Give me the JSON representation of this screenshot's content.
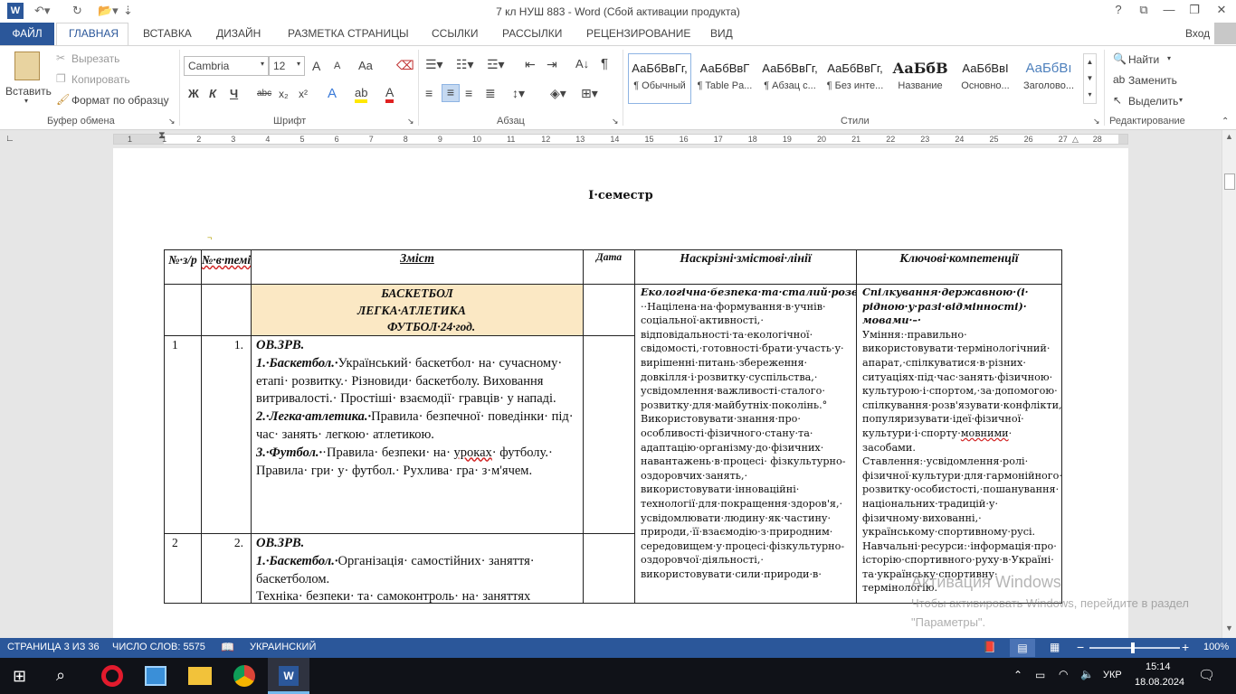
{
  "window": {
    "title": "7 кл НУШ 883 - Word (Сбой активации продукта)",
    "help": "?",
    "restore_ribbon": "⧉",
    "minimize": "—",
    "maximize": "❐",
    "close": "✕"
  },
  "tabs": {
    "file": "ФАЙЛ",
    "items": [
      "ГЛАВНАЯ",
      "ВСТАВКА",
      "ДИЗАЙН",
      "РАЗМЕТКА СТРАНИЦЫ",
      "ССЫЛКИ",
      "РАССЫЛКИ",
      "РЕЦЕНЗИРОВАНИЕ",
      "ВИД"
    ],
    "signin": "Вход"
  },
  "ribbon": {
    "clipboard": {
      "paste": "Вставить",
      "cut": "Вырезать",
      "copy": "Копировать",
      "format_painter": "Формат по образцу",
      "label": "Буфер обмена"
    },
    "font": {
      "name": "Cambria",
      "size": "12",
      "label": "Шрифт",
      "grow": "A",
      "shrink": "A",
      "case": "Aa",
      "bold": "Ж",
      "italic": "К",
      "underline": "Ч",
      "strike": "abc",
      "sub": "x₂",
      "sup": "x²"
    },
    "paragraph": {
      "label": "Абзац"
    },
    "styles": {
      "label": "Стили",
      "items": [
        {
          "sample": "АаБбВвГг,",
          "name": "¶ Обычный"
        },
        {
          "sample": "АаБбВвГ",
          "name": "¶ Table Pa..."
        },
        {
          "sample": "АаБбВвГг,",
          "name": "¶ Абзац с..."
        },
        {
          "sample": "АаБбВвГг,",
          "name": "¶ Без инте..."
        },
        {
          "sample": "АаБбВ",
          "name": "Название"
        },
        {
          "sample": "АаБбВвI",
          "name": "Основно..."
        },
        {
          "sample": "АаБбВı",
          "name": "Заголово..."
        }
      ]
    },
    "editing": {
      "find": "Найти",
      "replace": "Заменить",
      "select": "Выделить",
      "label": "Редактирование"
    }
  },
  "ruler": {
    "numbers": [
      "1",
      "1",
      "2",
      "3",
      "4",
      "5",
      "6",
      "7",
      "8",
      "9",
      "10",
      "11",
      "12",
      "13",
      "14",
      "15",
      "16",
      "17",
      "18",
      "19",
      "20",
      "21",
      "22",
      "23",
      "24",
      "25",
      "26",
      "27",
      "28"
    ]
  },
  "document": {
    "semester_title": "І·семестр",
    "table": {
      "headers": {
        "num": "№·з/р",
        "num_topic": "№·в·темі",
        "content": "Зміст",
        "date": "Дата",
        "lines": "Наскрізні·змістові·лінії",
        "competencies": "Ключові·компетенції"
      },
      "section_row": {
        "line1": "БАСКЕТБОЛ",
        "line2": "ЛЕГКА·АТЛЕТИКА",
        "line3": "ФУТБОЛ·24·год."
      },
      "row1": {
        "num": "1",
        "num_topic": "1.",
        "c_orb": "ОВ.ЗРВ.",
        "c_bask_lbl": "1.·Баскетбол.·",
        "c_bask_text": "Український· баскетбол· на· сучасному· етапі· розвитку.· Різновиди· баскетболу.  Виховання витривалості.· Простіші· взаємодії· гравців· у нападі.",
        "c_la_lbl": "2.·Легка·атлетика.·",
        "c_la_text": "Правила· безпечної· поведінки· під· час· занять· легкою· атлетикою.",
        "c_fb_lbl": "3.·Футбол.·",
        "c_fb_text": "·Правила· безпеки· на· ",
        "c_fb_sq": "уроках",
        "c_fb_text2": "· футболу.· Правила· гри· у· футбол.· Рухлива· гра· з·м'ячем."
      },
      "row2": {
        "num": "2",
        "num_topic": "2.",
        "c_orb": "ОВ.ЗРВ.",
        "c_bask_lbl": "1.·Баскетбол.·",
        "c_bask_text": "Організація· самостійних· заняття· баскетболом.",
        "c_tail": "Техніка· безпеки· та· самоконтроль· на· заняттях"
      },
      "lines_cell": {
        "heading": "Екологічна·безпека·та·сталий·розвиток·",
        "text": "··Націлена·на·формування·в·учнів· соціальної·активності,· відповідальності·та·екологічної· свідомості,·готовності·брати·участь·у· вирішенні·питань·збереження· довкілля·і·розвитку·суспільства,· усвідомлення·важливості·сталого· розвитку·для·майбутніх·поколінь.° Використовувати·знання·про· особливості·фізичного·стану·та· адаптацію·організму·до·фізичних· навантажень·в·процесі· фізкультурно-оздоровчих·занять,· використовувати·інноваційні· технології·для·покращення·здоров'я,· усвідомлювати·людину·як·частину· природи,·її·взаємодію·з·природним· середовищем·у·процесі·фізкультурно- оздоровчої·діяльності,· використовувати·сили·природи·в·"
      },
      "competencies_cell": {
        "heading": "Спілкування·державною·(і· рідною·у·разі·відмінності)· мовами·–·",
        "text1": "Уміння:·правильно· використовувати·термінологічний· апарат,·спілкуватися·в·різних· ситуаціях·під·час·занять·фізичною· культурою·і·спортом,·за·допомогою· спілкування·розв'язувати·конфлікти,· популяризувати·ідеї·фізичної· культури·і·спорту·",
        "sq": "мовними",
        "text2": "· засобами.",
        "text3": "Ставлення:·усвідомлення·ролі· фізичної·культури·для·гармонійного· розвитку·особистості,·пошанування· національних·традицій·у· фізичному·вихованні,· українському·спортивному·русі.",
        "text4": "Навчальні·ресурси:·інформація·про· історію·спортивного·руху·в·Україні· та·українську·спортивну· термінологію."
      }
    }
  },
  "watermark": {
    "title": "Активация Windows",
    "text": "Чтобы активировать Windows, перейдите в раздел \"Параметры\"."
  },
  "statusbar": {
    "page": "СТРАНИЦА 3 ИЗ 36",
    "words": "ЧИСЛО СЛОВ: 5575",
    "language": "УКРАИНСКИЙ",
    "zoom_minus": "−",
    "zoom_plus": "+",
    "zoom": "100%"
  },
  "taskbar": {
    "lang": "УКР",
    "time": "15:14",
    "date": "18.08.2024"
  },
  "colors": {
    "accent": "#2b579a",
    "section_fill": "#fbe8c4",
    "taskbar": "#101218"
  }
}
